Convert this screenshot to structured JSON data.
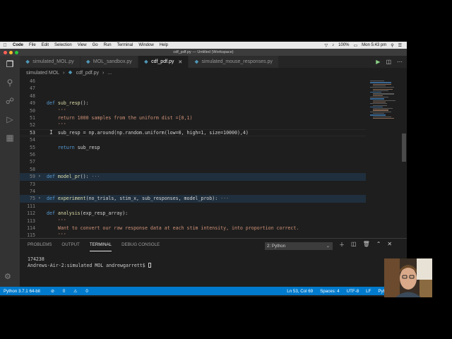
{
  "menubar": {
    "app": "Code",
    "items": [
      "File",
      "Edit",
      "Selection",
      "View",
      "Go",
      "Run",
      "Terminal",
      "Window",
      "Help"
    ],
    "battery": "100%",
    "clock": "Mon 5:43 pm"
  },
  "window": {
    "title": "cdf_pdf.py — Untitled (Workspace)"
  },
  "tabs": [
    {
      "label": "simulated_MOL.py",
      "active": false
    },
    {
      "label": "MOL_sandbox.py",
      "active": false
    },
    {
      "label": "cdf_pdf.py",
      "active": true
    },
    {
      "label": "simulated_mouse_responses.py",
      "active": false
    }
  ],
  "breadcrumb": {
    "folder": "simulated MOL",
    "file": "cdf_pdf.py",
    "more": "..."
  },
  "editor": {
    "current_line": "53",
    "lines": [
      {
        "n": "46",
        "text": ""
      },
      {
        "n": "47",
        "text": ""
      },
      {
        "n": "48",
        "text": ""
      },
      {
        "n": "49",
        "kw": "def ",
        "fn": "sub_resp",
        "rest": "():"
      },
      {
        "n": "50",
        "indent": "    ",
        "str": "'''"
      },
      {
        "n": "51",
        "indent": "    ",
        "str": "return 1000 samples from the uniform dist =[0,1)"
      },
      {
        "n": "52",
        "indent": "    ",
        "str": "'''"
      },
      {
        "n": "53",
        "indent": "    ",
        "text": "sub_resp = np.around(np.random.uniform(low=0, high=1, size=10000),4)"
      },
      {
        "n": "54",
        "text": ""
      },
      {
        "n": "55",
        "indent": "    ",
        "kw": "return ",
        "rest": "sub_resp"
      },
      {
        "n": "56",
        "text": ""
      },
      {
        "n": "57",
        "text": ""
      },
      {
        "n": "58",
        "text": ""
      },
      {
        "n": "59",
        "kw": "def ",
        "fn": "model_pr",
        "rest": "():",
        "folded": true,
        "dots": "···"
      },
      {
        "n": "73",
        "text": ""
      },
      {
        "n": "74",
        "text": ""
      },
      {
        "n": "75",
        "kw": "def ",
        "fn": "experiment",
        "rest": "(no_trials, stim_x, sub_responses, model_prob):",
        "folded": true,
        "dots": "···"
      },
      {
        "n": "111",
        "text": ""
      },
      {
        "n": "112",
        "kw": "def ",
        "fn": "analysis",
        "rest": "(exp_resp_array):"
      },
      {
        "n": "113",
        "indent": "    ",
        "str": "'''"
      },
      {
        "n": "114",
        "indent": "    ",
        "str": "Want to convert our raw response data at each stim intensity, into proportion correct."
      },
      {
        "n": "115",
        "indent": "    ",
        "str": "'''"
      }
    ]
  },
  "panel": {
    "tabs": [
      "PROBLEMS",
      "OUTPUT",
      "TERMINAL",
      "DEBUG CONSOLE"
    ],
    "active_tab": "TERMINAL",
    "terminal_select": "2: Python",
    "terminal_lines": [
      "174238",
      "Andrews-Air-2:simulated MOL andrewgarrett$ "
    ]
  },
  "statusbar": {
    "python": "Python 3.7.1 64-bit",
    "errors": "0",
    "warnings": "0",
    "position": "Ln 53, Col 69",
    "spaces": "Spaces: 4",
    "encoding": "UTF-8",
    "eol": "LF",
    "language": "Python"
  },
  "colors": {
    "accent": "#007acc",
    "editor_bg": "#1e1e1e",
    "keyword": "#569cd6",
    "function": "#dcdcaa",
    "string": "#ce9178"
  }
}
